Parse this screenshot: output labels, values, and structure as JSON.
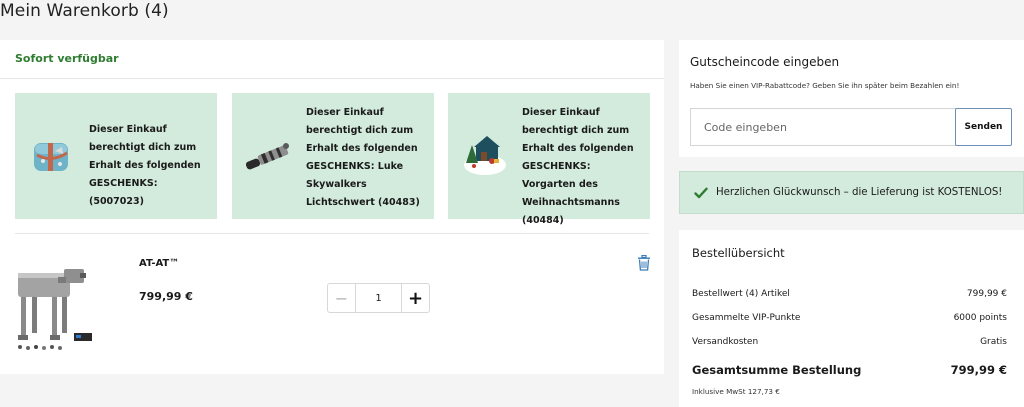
{
  "page": {
    "title": "Mein Warenkorb (4)"
  },
  "cart": {
    "availability_label": "Sofort verfügbar",
    "gifts": [
      {
        "text": "Dieser Einkauf berechtigt dich zum Erhalt des folgenden GESCHENKS: (5007023)",
        "icon": "gift-pillow-image"
      },
      {
        "text": "Dieser Einkauf berechtigt dich zum Erhalt des folgenden GESCHENKS: Luke Skywalkers Lichtschwert (40483)",
        "icon": "lightsaber-image"
      },
      {
        "text": "Dieser Einkauf berechtigt dich zum Erhalt des folgenden GESCHENKS: Vorgarten des Weihnachtsmanns (40484)",
        "icon": "santa-garden-image"
      }
    ],
    "product": {
      "name": "AT-AT™",
      "price": "799,99 €",
      "quantity": "1",
      "minus_symbol": "−",
      "plus_symbol": "+",
      "icon": "at-at-product-image"
    },
    "trash_icon": "trash-icon",
    "colors": {
      "accent_green": "#2e7d32",
      "gift_bg": "#d3ebdc",
      "link_blue": "#3a7cb8"
    }
  },
  "voucher": {
    "title": "Gutscheincode eingeben",
    "description": "Haben Sie einen VIP-Rabattcode? Geben Sie ihn später beim Bezahlen ein!",
    "input_placeholder": "Code eingeben",
    "submit_label": "Senden"
  },
  "shipping_banner": {
    "icon": "check-icon",
    "text": "Herzlichen Glückwunsch – die Lieferung ist KOSTENLOS!"
  },
  "summary": {
    "title": "Bestellübersicht",
    "rows": [
      {
        "label": "Bestellwert (4) Artikel",
        "value": "799,99 €"
      },
      {
        "label": "Gesammelte VIP-Punkte",
        "value": "6000 points"
      },
      {
        "label": "Versandkosten",
        "value": "Gratis"
      }
    ],
    "total_label": "Gesamtsumme Bestellung",
    "total_value": "799,99 €",
    "vat_note": "Inklusive MwSt 127,73 €"
  }
}
